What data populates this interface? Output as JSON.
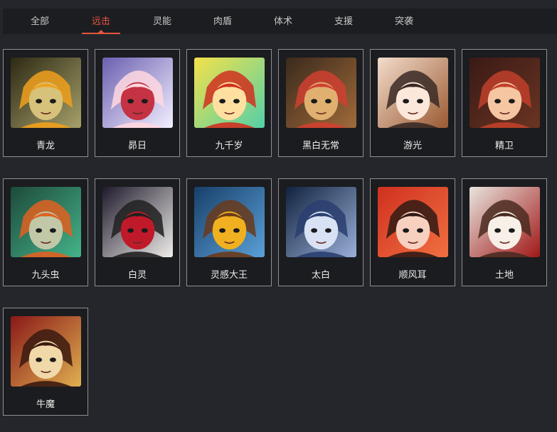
{
  "tabs": [
    {
      "label": "全部"
    },
    {
      "label": "远击",
      "active": true
    },
    {
      "label": "灵能"
    },
    {
      "label": "肉盾"
    },
    {
      "label": "体术"
    },
    {
      "label": "支援"
    },
    {
      "label": "突袭"
    }
  ],
  "characters": [
    {
      "name": "青龙",
      "icon": "portrait-qinglong",
      "palette": [
        "#2d2a14",
        "#a6a06a",
        "#d6c27a",
        "#f0a01c"
      ]
    },
    {
      "name": "昴日",
      "icon": "portrait-maori",
      "palette": [
        "#6a5fb0",
        "#f4f0ff",
        "#c43244",
        "#ffd8e0"
      ]
    },
    {
      "name": "九千岁",
      "icon": "portrait-jiuqiansui",
      "palette": [
        "#f5e14a",
        "#53d0a8",
        "#ffe0a0",
        "#d03020"
      ]
    },
    {
      "name": "黑白无常",
      "icon": "portrait-heibaiwuchang",
      "palette": [
        "#3a2a1c",
        "#a06a3a",
        "#e0b070",
        "#d04030"
      ]
    },
    {
      "name": "游光",
      "icon": "portrait-youguang",
      "palette": [
        "#f3dccb",
        "#9a5a32",
        "#fbe8da",
        "#3a2a26"
      ]
    },
    {
      "name": "精卫",
      "icon": "portrait-jingwei",
      "palette": [
        "#3a1a16",
        "#6a3422",
        "#f6c6a2",
        "#c0402a"
      ]
    },
    {
      "name": "九头虫",
      "icon": "portrait-jiutouchong",
      "palette": [
        "#1e4a3a",
        "#44b48a",
        "#c0c8a8",
        "#e06020"
      ]
    },
    {
      "name": "白灵",
      "icon": "portrait-bailing",
      "palette": [
        "#1e1a2c",
        "#f0eeea",
        "#c01a2a",
        "#202020"
      ]
    },
    {
      "name": "灵感大王",
      "icon": "portrait-linggandawang",
      "palette": [
        "#18406a",
        "#5aa0d8",
        "#f0b020",
        "#6a3a1a"
      ]
    },
    {
      "name": "太白",
      "icon": "portrait-taibai",
      "palette": [
        "#10223e",
        "#9ab0d8",
        "#d8e2f4",
        "#2a3e70"
      ]
    },
    {
      "name": "顺风耳",
      "icon": "portrait-shunfenger",
      "palette": [
        "#d03020",
        "#f07040",
        "#f8d0c0",
        "#301a14"
      ]
    },
    {
      "name": "土地",
      "icon": "portrait-tudi",
      "palette": [
        "#e8e4de",
        "#a01818",
        "#f8f0e8",
        "#4a2a20"
      ]
    },
    {
      "name": "牛魔",
      "icon": "portrait-niumo",
      "palette": [
        "#8a1818",
        "#e0b050",
        "#f0d8a8",
        "#3a1a10"
      ]
    }
  ]
}
